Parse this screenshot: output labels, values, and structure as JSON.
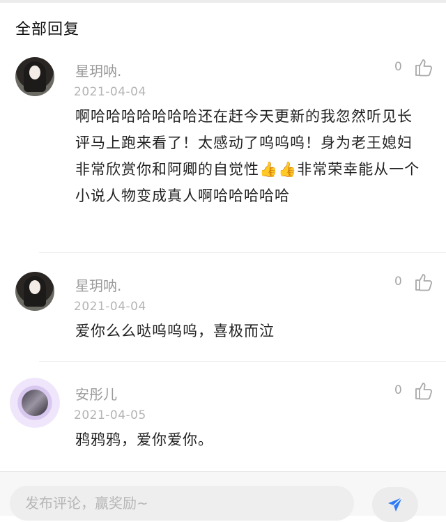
{
  "section_title": "全部回复",
  "comments": [
    {
      "username": "星玥呐.",
      "date": "2021-04-04",
      "likes": "0",
      "text": "啊哈哈哈哈哈哈哈还在赶今天更新的我忽然听见长评马上跑来看了！太感动了呜呜呜！身为老王媳妇非常欣赏你和阿卿的自觉性👍👍非常荣幸能从一个小说人物变成真人啊哈哈哈哈哈"
    },
    {
      "username": "星玥呐.",
      "date": "2021-04-04",
      "likes": "0",
      "text": "爱你么么哒呜呜呜，喜极而泣"
    },
    {
      "username": "安彤儿",
      "date": "2021-04-05",
      "likes": "0",
      "text": "鸦鸦鸦，爱你爱你。"
    }
  ],
  "composer": {
    "placeholder": "发布评论，赢奖励~"
  },
  "icons": {
    "like": "thumbs-up-icon",
    "send": "paper-plane-icon"
  },
  "colors": {
    "send_icon": "#2f7cf6",
    "meta_text": "#9a9a9a"
  }
}
